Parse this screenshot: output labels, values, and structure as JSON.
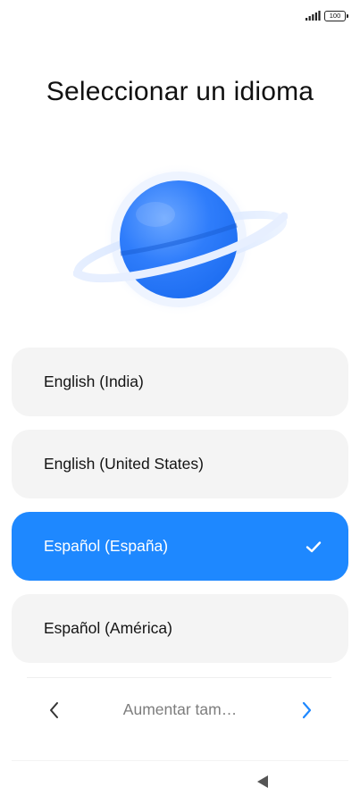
{
  "status_bar": {
    "battery_level": "100",
    "icons": [
      "signal-icon",
      "battery-icon"
    ]
  },
  "title": "Seleccionar un idioma",
  "illustration": "planet-icon",
  "languages": [
    {
      "label": "English (India)",
      "selected": false
    },
    {
      "label": "English (United States)",
      "selected": false
    },
    {
      "label": "Español (España)",
      "selected": true
    },
    {
      "label": "Español (América)",
      "selected": false
    }
  ],
  "bottom_nav": {
    "prev_icon": "chevron-left-icon",
    "increase_size_label": "Aumentar tam…",
    "next_icon": "chevron-right-icon"
  },
  "system_nav": {
    "back_icon": "back-triangle-icon"
  },
  "colors": {
    "accent": "#1e88ff",
    "option_bg": "#f4f4f4",
    "muted_text": "#7d7d7d"
  }
}
